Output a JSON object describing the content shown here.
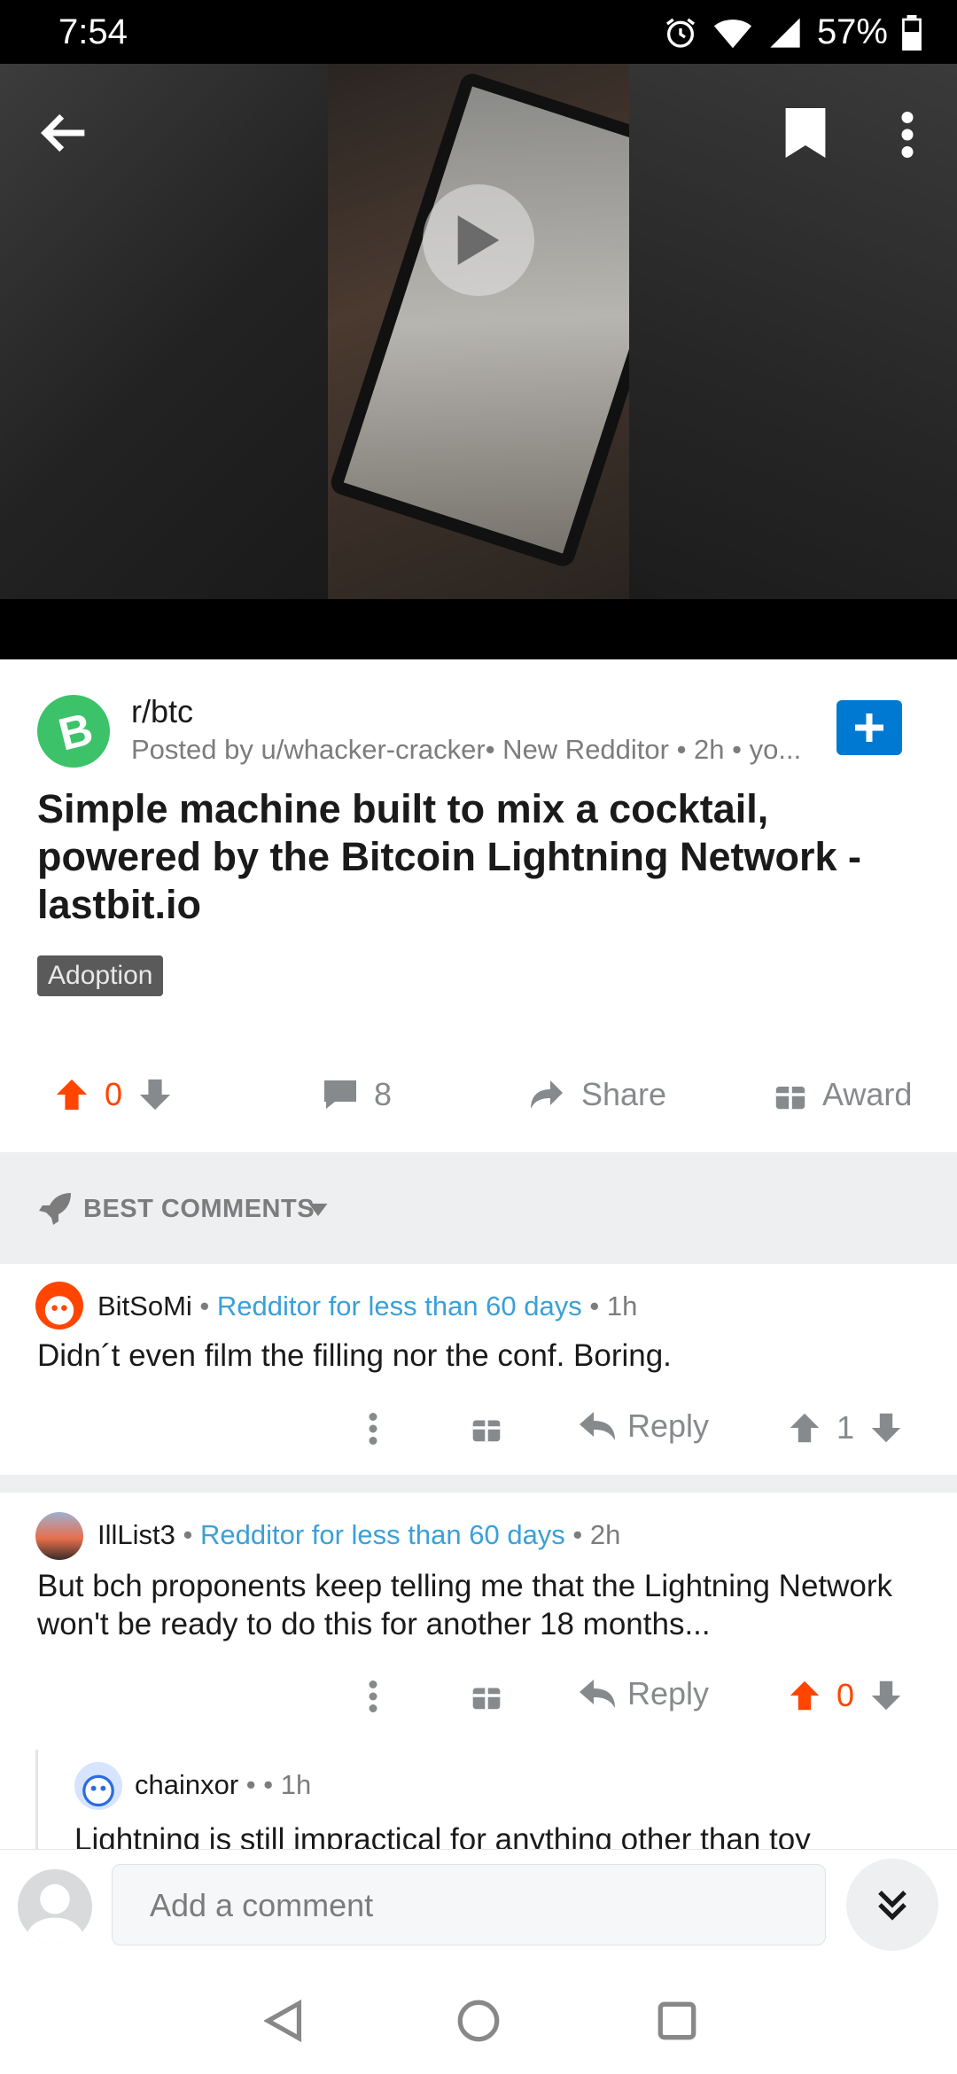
{
  "status_bar": {
    "time": "7:54",
    "battery": "57%"
  },
  "post": {
    "subreddit": "r/btc",
    "posted_by": "Posted by u/whacker-cracker• New Redditor • 2h • yo...",
    "title": "Simple machine built to mix a cocktail, powered by the Bitcoin Lightning Network - lastbit.io",
    "flair": "Adoption",
    "score": "0",
    "comments": "8",
    "share_label": "Share",
    "award_label": "Award"
  },
  "sort": {
    "label": "BEST COMMENTS"
  },
  "comments": [
    {
      "author": "BitSoMi",
      "flair": "Redditor for less than 60 days",
      "time": "1h",
      "body": "Didn´t even film the filling nor the conf. Boring.",
      "reply_label": "Reply",
      "score": "1"
    },
    {
      "author": "IllList3",
      "flair": "Redditor for less than 60 days",
      "time": "2h",
      "body": "But bch proponents keep telling me that the Lightning Network won't be ready to do this for another 18 months...",
      "reply_label": "Reply",
      "score": "0"
    },
    {
      "author": "chainxor",
      "flair": "",
      "time": "1h",
      "body": "Lightning is still impractical for anything other than toy"
    }
  ],
  "compose": {
    "placeholder": "Add a comment"
  },
  "colors": {
    "upvote": "#ff4500",
    "accent_blue": "#0079d3",
    "flair_blue": "#3aa0d8"
  }
}
